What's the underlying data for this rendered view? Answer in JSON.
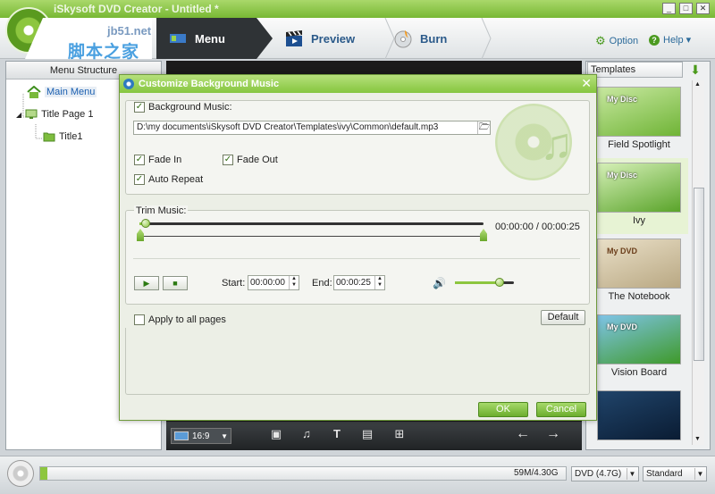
{
  "app": {
    "title": "iSkysoft DVD Creator - Untitled *",
    "window_controls": [
      "_",
      "□",
      "✕"
    ]
  },
  "watermark": {
    "top": "jb51.net",
    "main": "脚本之家"
  },
  "nav": {
    "tabs": [
      {
        "label": "Menu",
        "icon": "menu-icon",
        "active": true
      },
      {
        "label": "Preview",
        "icon": "clapperboard-icon",
        "active": false
      },
      {
        "label": "Burn",
        "icon": "burn-disc-icon",
        "active": false
      }
    ],
    "option_label": "Option",
    "help_label": "Help ▾"
  },
  "left_panel": {
    "header": "Menu Structure",
    "tree": [
      {
        "label": "Main Menu",
        "level": 0,
        "icon": "home-icon",
        "selected": true
      },
      {
        "label": "Title Page 1",
        "level": 0,
        "icon": "monitor-icon",
        "selected": false
      },
      {
        "label": "Title1",
        "level": 1,
        "icon": "folder-icon",
        "selected": false
      }
    ]
  },
  "canvas_toolbar": {
    "aspect_ratio": "16:9",
    "tools": [
      "image-icon",
      "music-icon",
      "text-icon",
      "chapter-icon",
      "add-thumbnail-icon"
    ],
    "prev_icon": "arrow-left-icon",
    "next_icon": "arrow-right-icon"
  },
  "templates": {
    "dropdown_label": "Templates",
    "items": [
      {
        "name": "Field Spotlight",
        "thumb_text": "My Disc",
        "selected": false,
        "colors": [
          "#6fb436",
          "#c8e8a0"
        ]
      },
      {
        "name": "Ivy",
        "thumb_text": "My Disc",
        "selected": true,
        "colors": [
          "#5aa42a",
          "#d6f0b8"
        ]
      },
      {
        "name": "The Notebook",
        "thumb_text": "My DVD",
        "selected": false,
        "colors": [
          "#b9a883",
          "#e9dfc7"
        ]
      },
      {
        "name": "Vision Board",
        "thumb_text": "My DVD",
        "selected": false,
        "colors": [
          "#3f9a2a",
          "#7fc4e8"
        ]
      },
      {
        "name": "",
        "thumb_text": "",
        "selected": false,
        "colors": [
          "#0a1c33",
          "#20446a"
        ]
      }
    ]
  },
  "status": {
    "capacity_text": "59M/4.30G",
    "disc_type": "DVD (4.7G)",
    "quality": "Standard",
    "capacity_fraction": 0.0134
  },
  "dialog": {
    "title": "Customize Background Music",
    "background_music_label": "Background Music:",
    "background_music_checked": true,
    "file_path": "D:\\my documents\\iSkysoft DVD Creator\\Templates\\ivy\\Common\\default.mp3",
    "fade_in_label": "Fade In",
    "fade_in_checked": true,
    "fade_out_label": "Fade Out",
    "fade_out_checked": true,
    "auto_repeat_label": "Auto Repeat",
    "auto_repeat_checked": true,
    "trim_label": "Trim Music:",
    "time_readout": "00:00:00 / 00:00:25",
    "start_label": "Start:",
    "start_value": "00:00:00",
    "end_label": "End:",
    "end_value": "00:00:25",
    "volume_fraction": 0.76,
    "apply_all_label": "Apply to all pages",
    "apply_all_checked": false,
    "default_label": "Default",
    "ok_label": "OK",
    "cancel_label": "Cancel"
  }
}
